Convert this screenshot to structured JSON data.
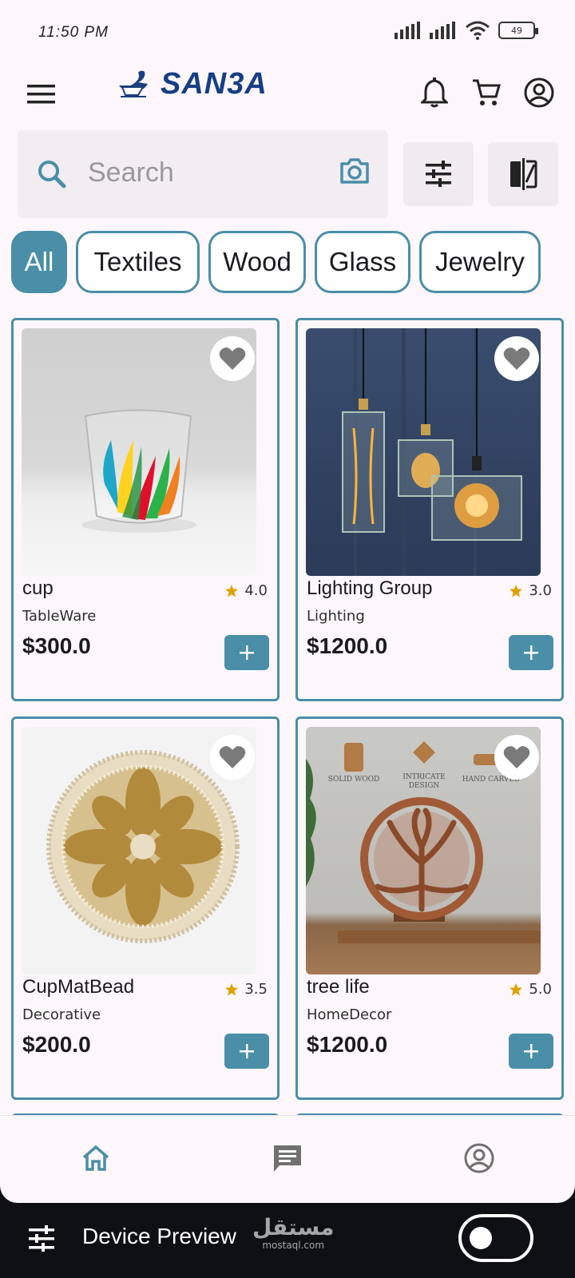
{
  "status_bar": {
    "time": "11:50 PM",
    "battery": "49"
  },
  "header": {
    "logo_text": "SAN3A",
    "icons": [
      "menu-icon",
      "bell-icon",
      "cart-icon",
      "account-circle-icon"
    ]
  },
  "search": {
    "placeholder": "Search"
  },
  "chips": [
    "All",
    "Textiles",
    "Wood",
    "Glass",
    "Jewelry"
  ],
  "products": [
    {
      "name": "cup",
      "category": "TableWare",
      "price": "$300.0",
      "rating": "4.0"
    },
    {
      "name": "Lighting Group",
      "category": "Lighting",
      "price": "$1200.0",
      "rating": "3.0"
    },
    {
      "name": "CupMatBead",
      "category": "Decorative",
      "price": "$200.0",
      "rating": "3.5"
    },
    {
      "name": "tree life",
      "category": "HomeDecor",
      "price": "$1200.0",
      "rating": "5.0",
      "image_labels": [
        "SOLID WOOD",
        "INTRICATE",
        "DESIGN",
        "HAND CARVED"
      ]
    }
  ],
  "bottom_nav": {
    "icons": [
      "home-icon",
      "chat-icon",
      "profile-icon"
    ]
  },
  "device_preview": {
    "label": "Device Preview",
    "watermark": "مستقل",
    "watermark_sub": "mostaql.com"
  },
  "colors": {
    "accent": "#4a8ea8",
    "brand": "#163e86",
    "background": "#fdf7fb",
    "star": "#e0a100"
  }
}
